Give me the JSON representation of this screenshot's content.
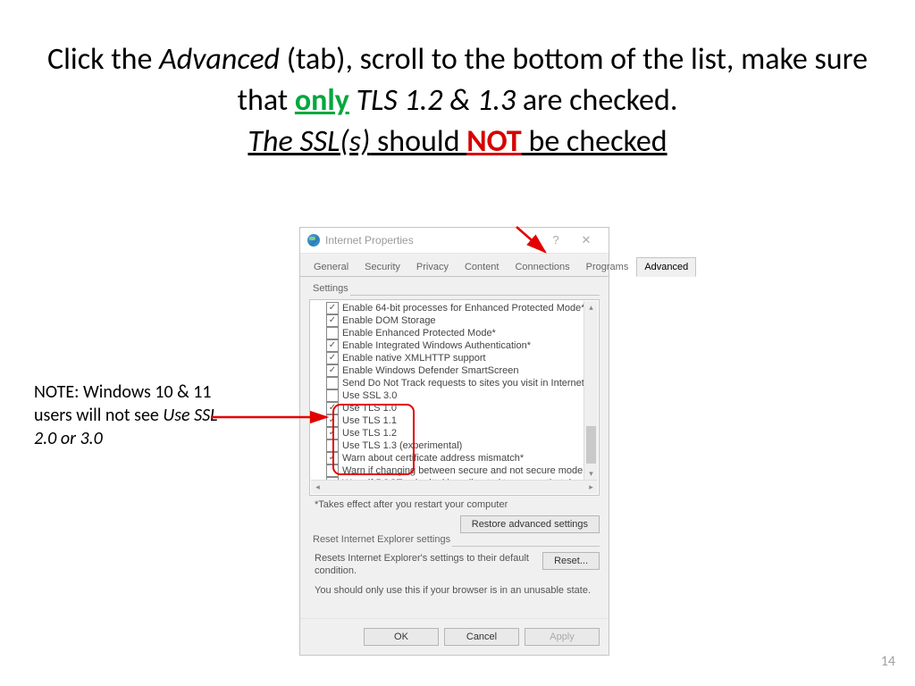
{
  "heading": {
    "part1": "Click the ",
    "advanced": "Advanced",
    "part2": " (tab), scroll to the bottom of the list, make sure that ",
    "only": "only",
    "space": " ",
    "tls": "TLS 1.2 & 1.3",
    "part3": " are checked. ",
    "ssls": "The SSL(s)",
    "part4": " should ",
    "not": "NOT",
    "part5": " be checked"
  },
  "note": {
    "pre": "NOTE:  Windows 10 & 11 users will not see ",
    "ital": "Use SSL 2.0 or 3.0"
  },
  "page_number": "14",
  "dialog": {
    "title": "Internet Properties",
    "help_glyph": "?",
    "close_glyph": "✕",
    "tabs": [
      "General",
      "Security",
      "Privacy",
      "Content",
      "Connections",
      "Programs",
      "Advanced"
    ],
    "active_tab": 6,
    "settings_legend": "Settings",
    "settings_items": [
      {
        "label": "Enable 64-bit processes for Enhanced Protected Mode*",
        "checked": true
      },
      {
        "label": "Enable DOM Storage",
        "checked": true
      },
      {
        "label": "Enable Enhanced Protected Mode*",
        "checked": false
      },
      {
        "label": "Enable Integrated Windows Authentication*",
        "checked": true
      },
      {
        "label": "Enable native XMLHTTP support",
        "checked": true
      },
      {
        "label": "Enable Windows Defender SmartScreen",
        "checked": true
      },
      {
        "label": "Send Do Not Track requests to sites you visit in Internet E",
        "checked": false
      },
      {
        "label": "Use SSL 3.0",
        "checked": false
      },
      {
        "label": "Use TLS 1.0",
        "checked": true
      },
      {
        "label": "Use TLS 1.1",
        "checked": true
      },
      {
        "label": "Use TLS 1.2",
        "checked": true
      },
      {
        "label": "Use TLS 1.3 (experimental)",
        "checked": false
      },
      {
        "label": "Warn about certificate address mismatch*",
        "checked": true
      },
      {
        "label": "Warn if changing between secure and not secure mode",
        "checked": false
      },
      {
        "label": "Warn if POST submittal is redirected to a zone that does n",
        "checked": false
      }
    ],
    "restart_note": "*Takes effect after you restart your computer",
    "restore_btn": "Restore advanced settings",
    "reset_legend": "Reset Internet Explorer settings",
    "reset_text": "Resets Internet Explorer's settings to their default condition.",
    "reset_btn": "Reset...",
    "reset_warn": "You should only use this if your browser is in an unusable state.",
    "ok": "OK",
    "cancel": "Cancel",
    "apply": "Apply"
  }
}
